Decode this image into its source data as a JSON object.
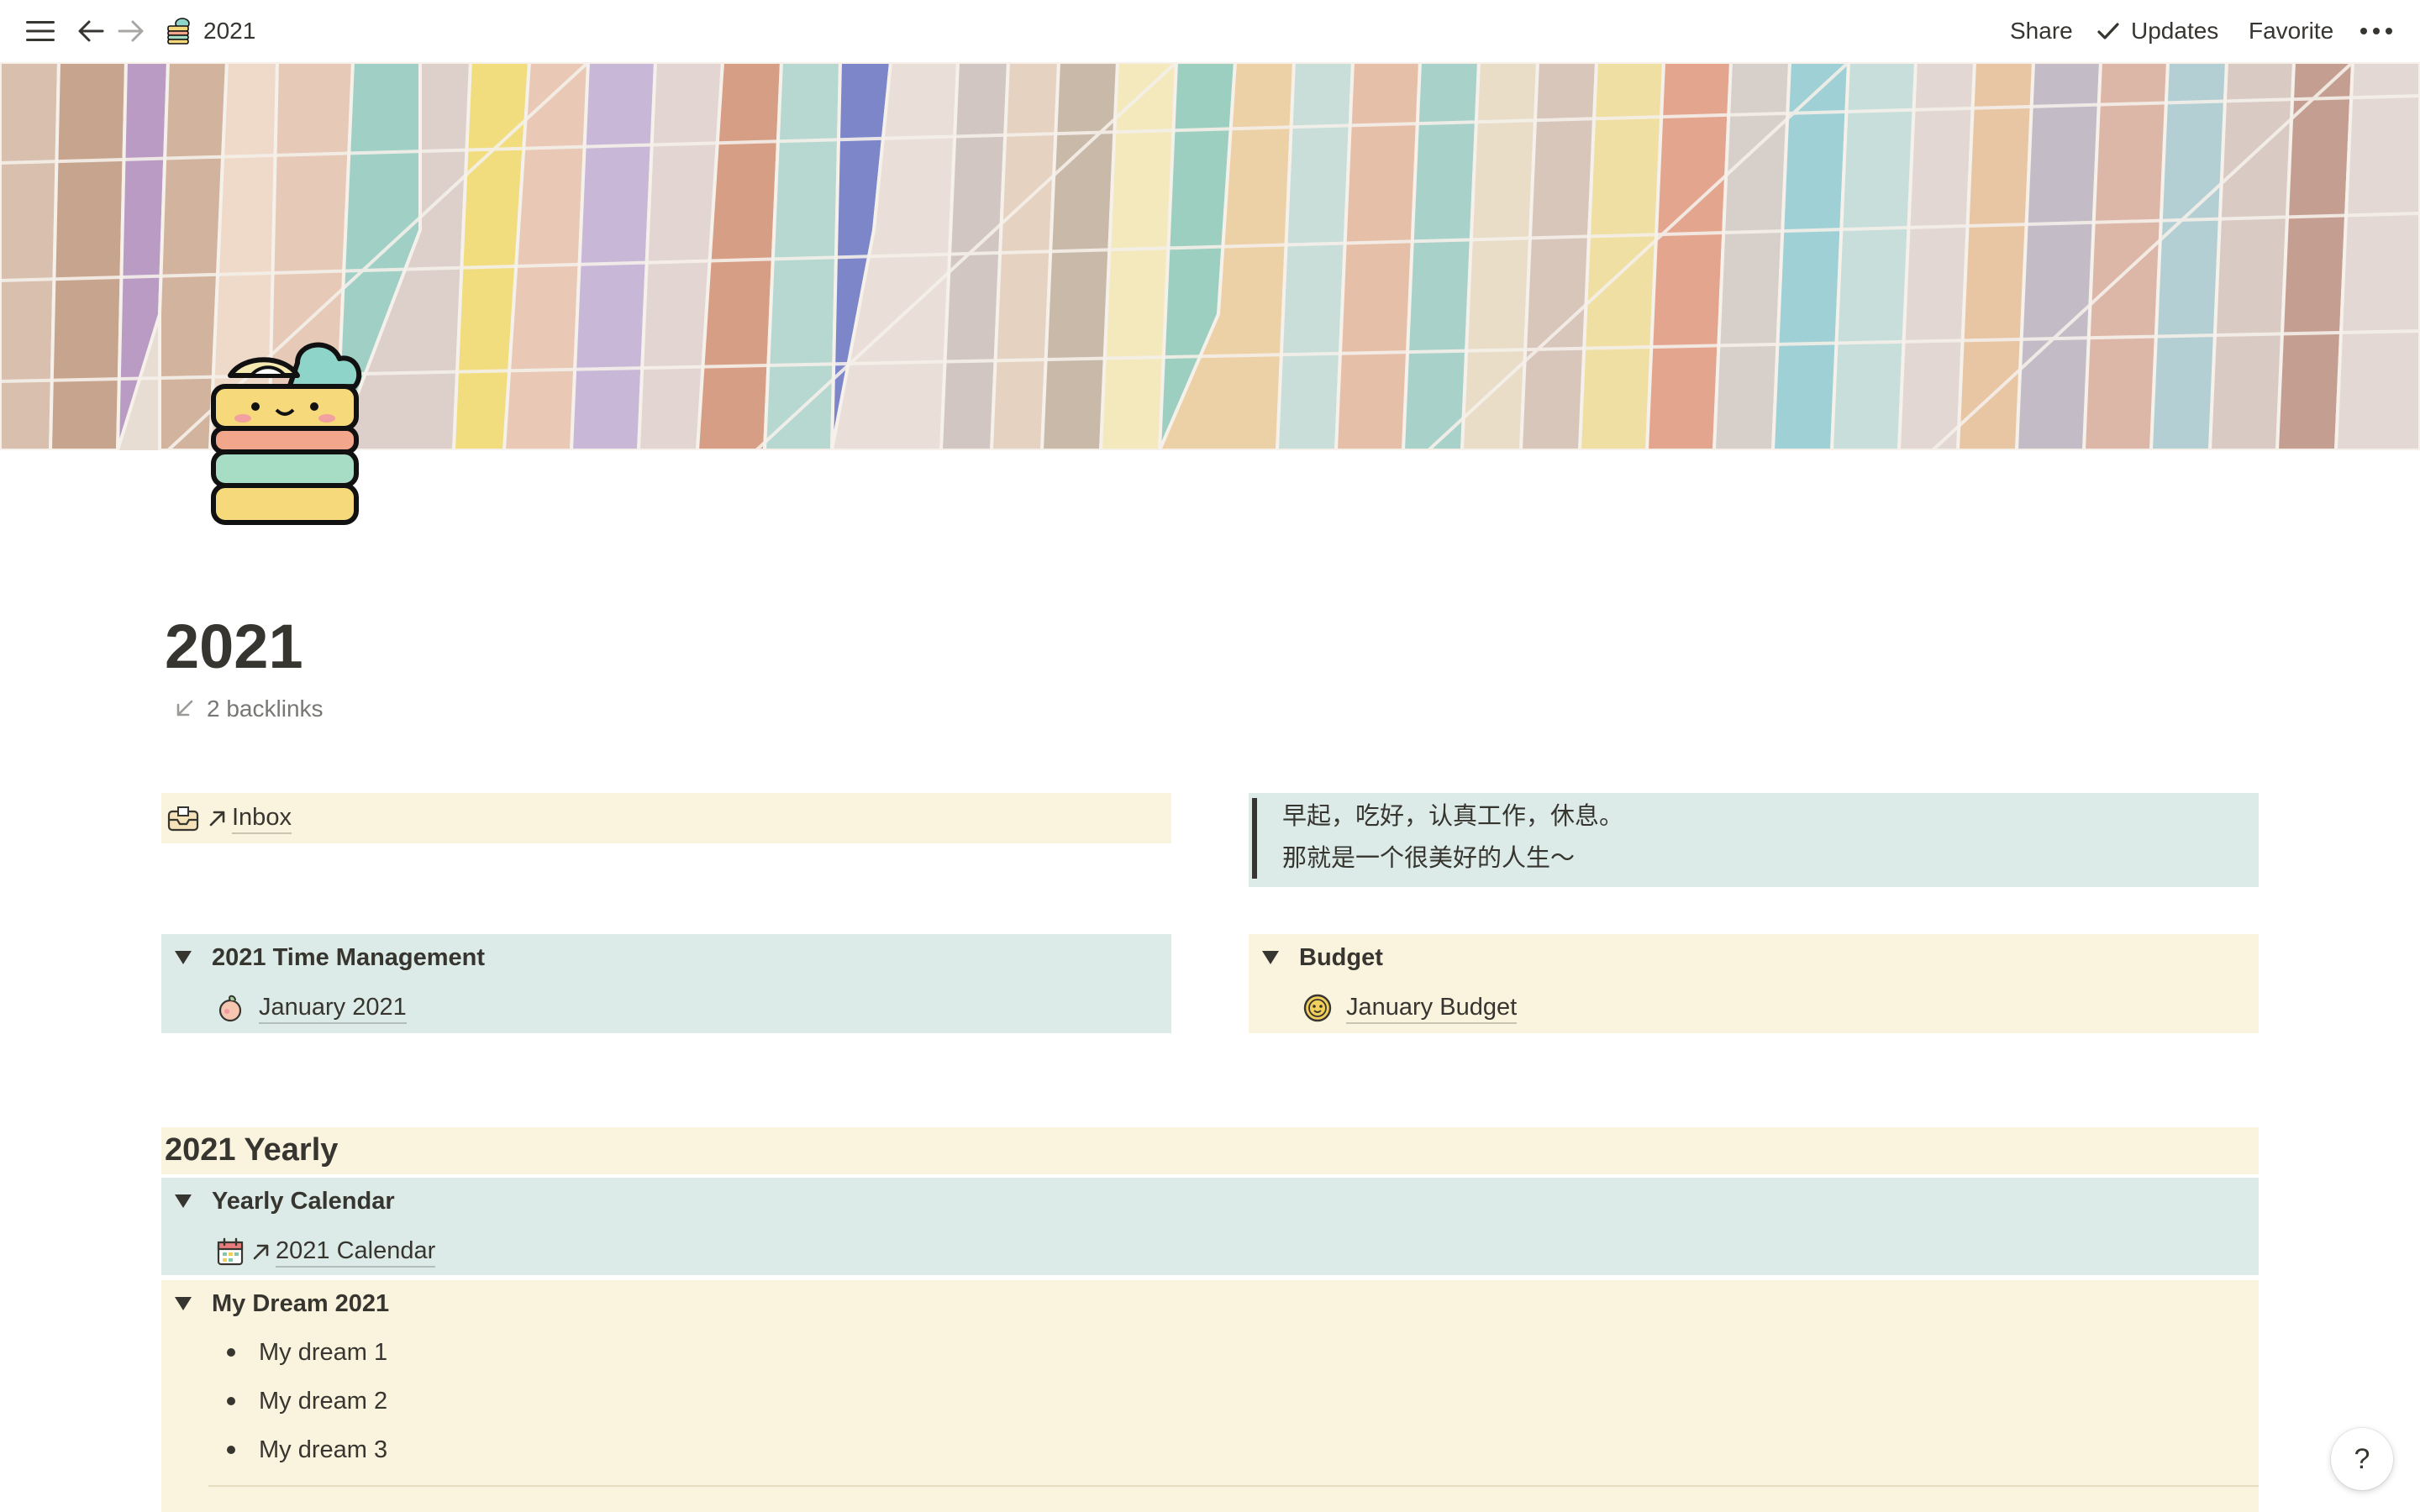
{
  "topbar": {
    "breadcrumb_title": "2021",
    "share_label": "Share",
    "updates_label": "Updates",
    "favorite_label": "Favorite"
  },
  "page": {
    "title": "2021",
    "backlinks": "2 backlinks"
  },
  "inbox": {
    "label": "Inbox"
  },
  "quote": {
    "line1": "早起，吃好，认真工作，休息。",
    "line2": "那就是一个很美好的人生～"
  },
  "time_management": {
    "title": "2021 Time Management",
    "item": "January 2021"
  },
  "budget": {
    "title": "Budget",
    "item": "January Budget"
  },
  "yearly": {
    "heading": "2021 Yearly",
    "calendar_toggle": "Yearly Calendar",
    "calendar_link": "2021 Calendar",
    "dream_toggle": "My Dream 2021",
    "dreams": [
      "My dream 1",
      "My dream 2",
      "My dream 3"
    ]
  },
  "help": {
    "label": "?"
  },
  "colors": {
    "yellow_bg": "#faf3dd",
    "teal_bg": "#ddebe8",
    "text": "#37352f",
    "muted": "#787774"
  }
}
